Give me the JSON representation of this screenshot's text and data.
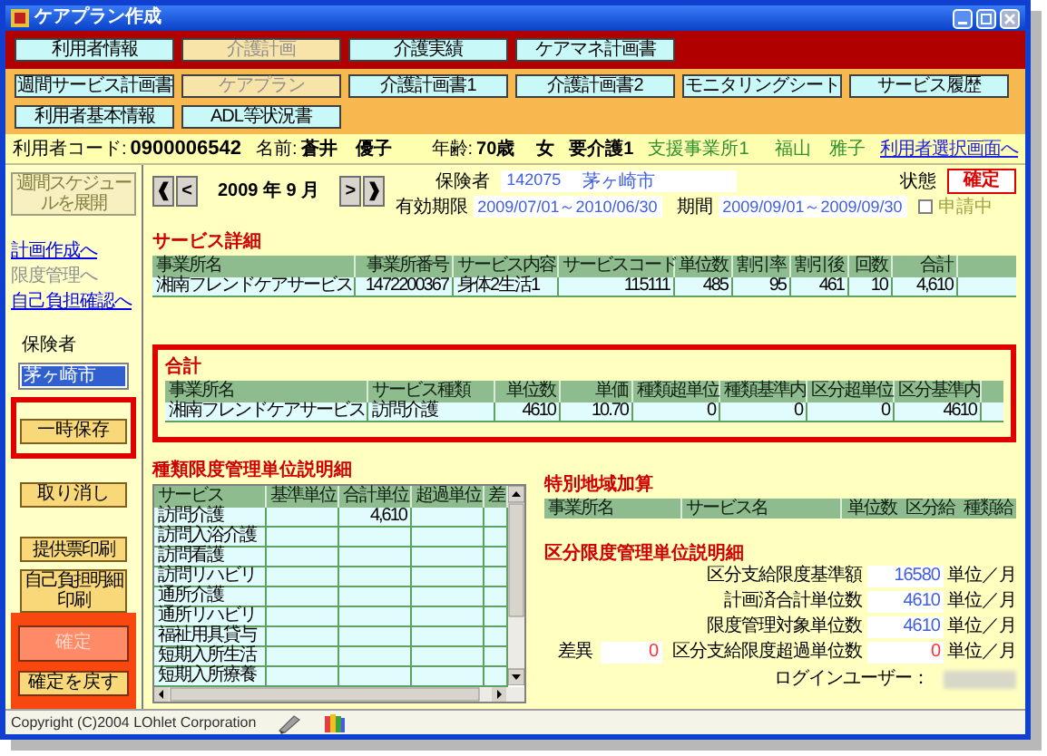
{
  "window": {
    "title": "ケアプラン作成"
  },
  "main_tabs": [
    {
      "label": "利用者情報",
      "selected": false
    },
    {
      "label": "介護計画",
      "selected": true
    },
    {
      "label": "介護実績",
      "selected": false
    },
    {
      "label": "ケアマネ計画書",
      "selected": false
    }
  ],
  "sub_tabs": [
    {
      "label": "週間サービス計画書",
      "selected": false
    },
    {
      "label": "ケアプラン",
      "selected": true
    },
    {
      "label": "介護計画書1",
      "selected": false
    },
    {
      "label": "介護計画書2",
      "selected": false
    },
    {
      "label": "モニタリングシート",
      "selected": false
    },
    {
      "label": "サービス履歴",
      "selected": false
    },
    {
      "label": "利用者基本情報",
      "selected": false
    },
    {
      "label": "ADL等状況書",
      "selected": false
    }
  ],
  "client_bar": {
    "code_label": "利用者コード:",
    "code": "0900006542",
    "name_label": "名前:",
    "name": "蒼井　優子",
    "age_label": "年齢:",
    "age": "70歳",
    "sex": "女",
    "care_level": "要介護1",
    "office": "支援事業所1",
    "manager": "福山　雅子",
    "link": "利用者選択画面へ"
  },
  "sidebar": {
    "expand_button": "週間スケジュールを展開",
    "links": [
      {
        "label": "計画作成へ",
        "disabled": false
      },
      {
        "label": "限度管理へ",
        "disabled": true
      },
      {
        "label": "自己負担確認へ",
        "disabled": false
      }
    ],
    "insurer_label": "保険者",
    "insurers": [
      {
        "label": "茅ヶ崎市",
        "selected": true
      }
    ],
    "edit_buttons": [
      {
        "label": "一時保存",
        "highlighted": true
      },
      {
        "label": "取り消し",
        "highlighted": false
      }
    ],
    "print_buttons": [
      "提供票印刷",
      "自己負担明細印刷"
    ],
    "confirm_buttons": [
      {
        "label": "確定",
        "disabled": true
      },
      {
        "label": "確定を戻す",
        "disabled": false
      }
    ]
  },
  "period_nav": {
    "first": "❰",
    "prev": "<",
    "month": "2009 年 9 月",
    "next": ">",
    "last": "❱"
  },
  "plan_info": {
    "insurer_label": "保険者",
    "insurer_no": "142075",
    "insurer_name": "茅ヶ崎市",
    "validity_label": "有効期限",
    "validity": "2009/07/01～2010/06/30",
    "period_label": "期間",
    "period": "2009/09/01～2009/09/30",
    "applying": {
      "label": "申請中",
      "checked": false
    },
    "status_label": "状態",
    "status": "確定"
  },
  "service_detail": {
    "title": "サービス詳細",
    "columns": [
      "事業所名",
      "事業所番号",
      "サービス内容",
      "サービスコード",
      "単位数",
      "割引率",
      "割引後",
      "回数",
      "合計"
    ],
    "rows": [
      [
        "湘南フレンドケアサービス",
        "1472200367",
        "身体2生活1",
        "115111",
        "485",
        "95",
        "461",
        "10",
        "4,610"
      ]
    ]
  },
  "total": {
    "title": "合計",
    "highlighted": true,
    "columns": [
      "事業所名",
      "サービス種類",
      "単位数",
      "単価",
      "種類超単位",
      "種類基準内",
      "区分超単位",
      "区分基準内"
    ],
    "rows": [
      [
        "湘南フレンドケアサービス",
        "訪問介護",
        "4610",
        "10.70",
        "0",
        "0",
        "0",
        "4610"
      ]
    ]
  },
  "type_limit": {
    "title": "種類限度管理単位説明細",
    "columns": [
      "サービス",
      "基準単位",
      "合計単位",
      "超過単位",
      "差"
    ],
    "rows": [
      {
        "service": "訪問介護",
        "total": "4,610"
      },
      {
        "service": "訪問入浴介護"
      },
      {
        "service": "訪問看護"
      },
      {
        "service": "訪問リハビリ"
      },
      {
        "service": "通所介護"
      },
      {
        "service": "通所リハビリ"
      },
      {
        "service": "福祉用具貸与"
      },
      {
        "service": "短期入所生活"
      },
      {
        "service": "短期入所療養"
      }
    ]
  },
  "special_area": {
    "title": "特別地域加算",
    "columns": [
      "事業所名",
      "サービス名",
      "単位数",
      "区分給",
      "種類給"
    ]
  },
  "category_limit": {
    "title": "区分限度管理単位説明細",
    "rows": [
      {
        "label": "区分支給限度基準額",
        "value": "16580",
        "unit": "単位／月",
        "alert": false
      },
      {
        "label": "計画済合計単位数",
        "value": "4610",
        "unit": "単位／月",
        "alert": false
      },
      {
        "label": "限度管理対象単位数",
        "value": "4610",
        "unit": "単位／月",
        "alert": false
      },
      {
        "label": "区分支給限度超過単位数",
        "value": "0",
        "unit": "単位／月",
        "alert": true
      }
    ],
    "difference": {
      "label": "差異",
      "value": "0",
      "alert": true
    }
  },
  "login": {
    "label": "ログインユーザー："
  },
  "status_bar": {
    "copyright": "Copyright (C)2004 LOhlet Corporation"
  }
}
